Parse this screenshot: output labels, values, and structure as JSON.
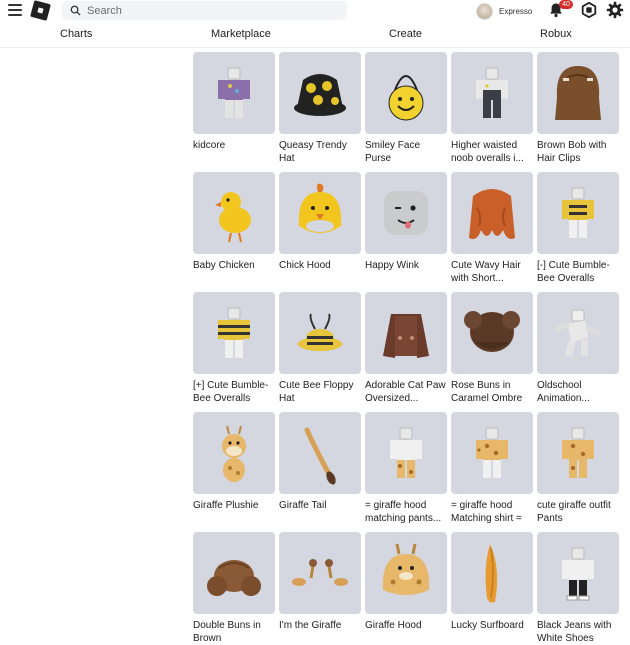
{
  "header": {
    "search_placeholder": "Search",
    "username": "Expresso",
    "notification_count": "40",
    "icons": [
      "menu-icon",
      "roblox-logo",
      "search-icon",
      "bell-icon",
      "robux-icon",
      "gear-icon"
    ]
  },
  "nav": {
    "charts": "Charts",
    "marketplace": "Marketplace",
    "create": "Create",
    "robux": "Robux"
  },
  "items": [
    {
      "name": "kidcore",
      "art": "figure-kidcore"
    },
    {
      "name": "Queasy Trendy Hat",
      "art": "bucket-hat"
    },
    {
      "name": "Smiley Face Purse",
      "art": "smiley-purse"
    },
    {
      "name": "Higher waisted noob overalls i...",
      "art": "figure-overalls"
    },
    {
      "name": "Brown Bob with Hair Clips",
      "art": "brown-bob"
    },
    {
      "name": "Baby Chicken",
      "art": "chick"
    },
    {
      "name": "Chick Hood",
      "art": "chick-hood"
    },
    {
      "name": "Happy Wink",
      "art": "wink-face"
    },
    {
      "name": "Cute Wavy Hair with Short...",
      "art": "orange-hair"
    },
    {
      "name": "[-] Cute Bumble-Bee Overalls",
      "art": "figure-bee"
    },
    {
      "name": "[+] Cute Bumble-Bee Overalls",
      "art": "figure-bee2"
    },
    {
      "name": "Cute Bee Floppy Hat",
      "art": "bee-hat"
    },
    {
      "name": "Adorable Cat Paw Oversized...",
      "art": "brown-sweater"
    },
    {
      "name": "Rose Buns in Caramel Ombre",
      "art": "buns-hair"
    },
    {
      "name": "Oldschool Animation...",
      "art": "figure-pose"
    },
    {
      "name": "Giraffe Plushie",
      "art": "giraffe-plush"
    },
    {
      "name": "Giraffe Tail",
      "art": "giraffe-tail"
    },
    {
      "name": "= giraffe hood matching pants...",
      "art": "figure-giraffe-pants"
    },
    {
      "name": "= giraffe hood Matching shirt =",
      "art": "figure-giraffe-shirt"
    },
    {
      "name": "cute giraffe outfit Pants",
      "art": "figure-giraffe-outfit"
    },
    {
      "name": "Double Buns in Brown",
      "art": "double-buns"
    },
    {
      "name": "I'm the Giraffe",
      "art": "giraffe-horns"
    },
    {
      "name": "Giraffe Hood",
      "art": "giraffe-hood"
    },
    {
      "name": "Lucky Surfboard",
      "art": "surfboard"
    },
    {
      "name": "Black Jeans with White Shoes",
      "art": "figure-jeans"
    }
  ]
}
